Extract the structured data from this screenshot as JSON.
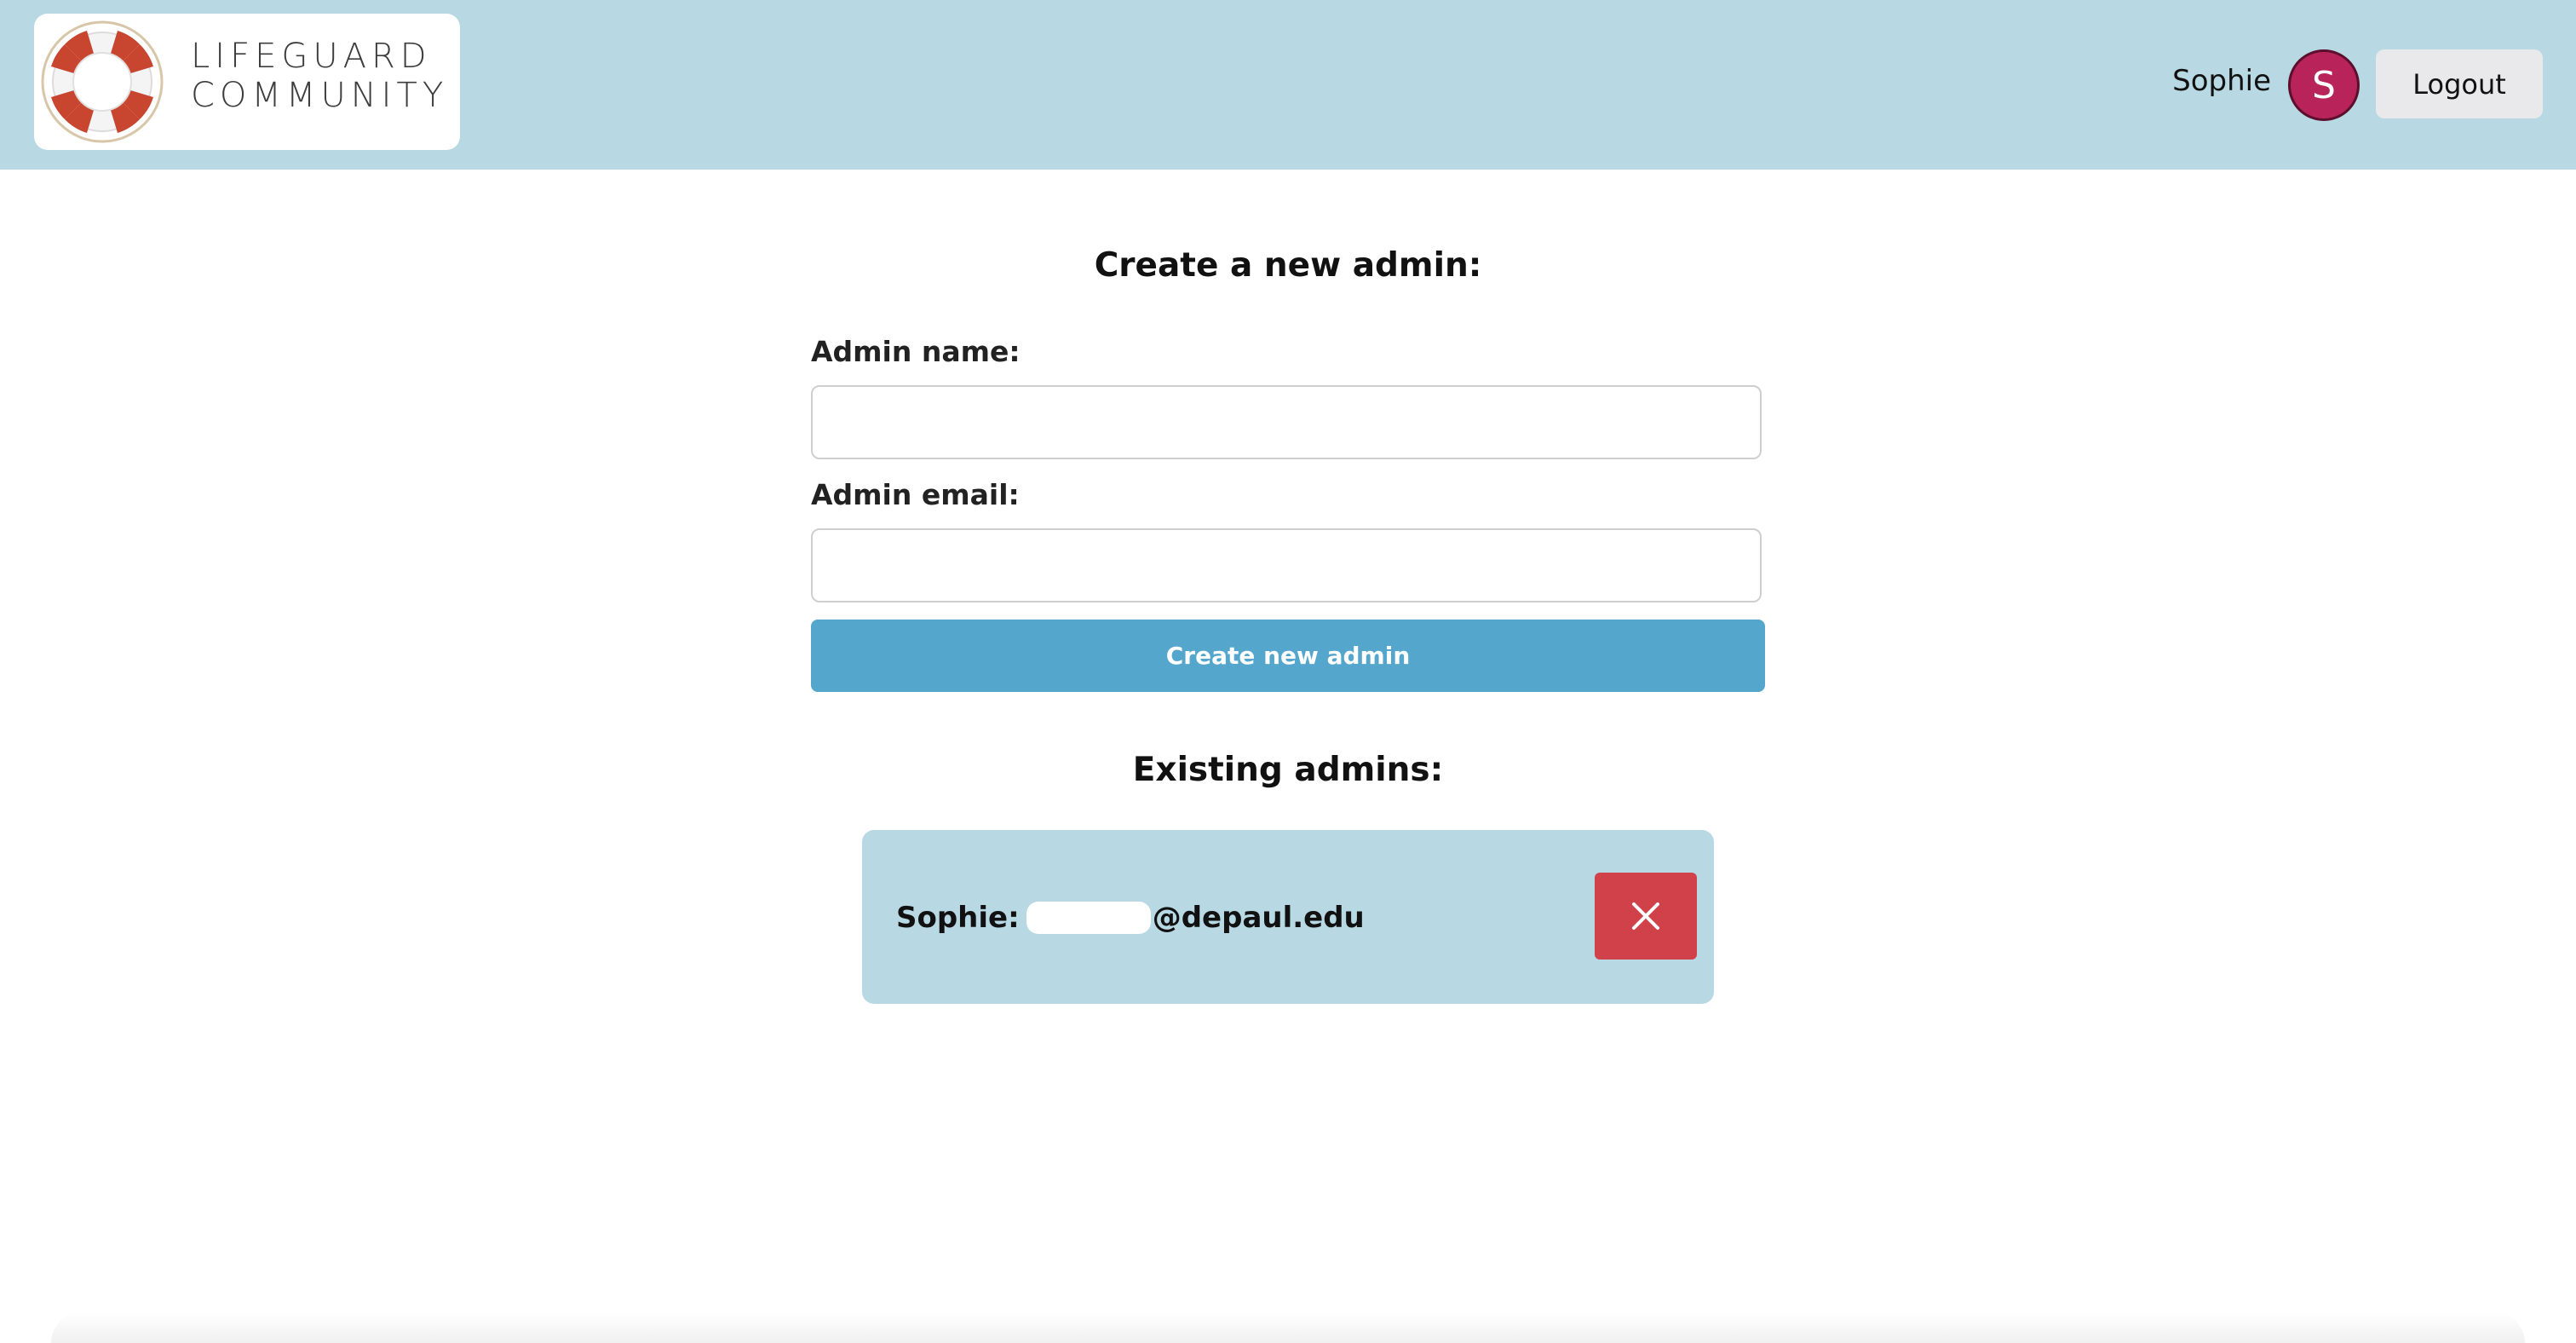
{
  "header": {
    "logo": {
      "line1": "LIFEGUARD",
      "line2": "COMMUNITY",
      "icon": "lifebuoy-icon"
    },
    "user_name": "Sophie",
    "avatar_initial": "S",
    "logout_label": "Logout"
  },
  "create_form": {
    "title": "Create a new admin:",
    "name_label": "Admin name:",
    "name_value": "",
    "email_label": "Admin email:",
    "email_value": "",
    "submit_label": "Create new admin"
  },
  "existing": {
    "title": "Existing admins:",
    "admins": [
      {
        "name": "Sophie:",
        "email_domain": "@depaul.edu",
        "delete_icon": "close-icon"
      }
    ]
  },
  "colors": {
    "header_bg": "#b8d9e3",
    "primary_button": "#55a6cc",
    "delete_button": "#d0414a",
    "avatar": "#b8245a",
    "card_bg": "#b8d9e3"
  }
}
